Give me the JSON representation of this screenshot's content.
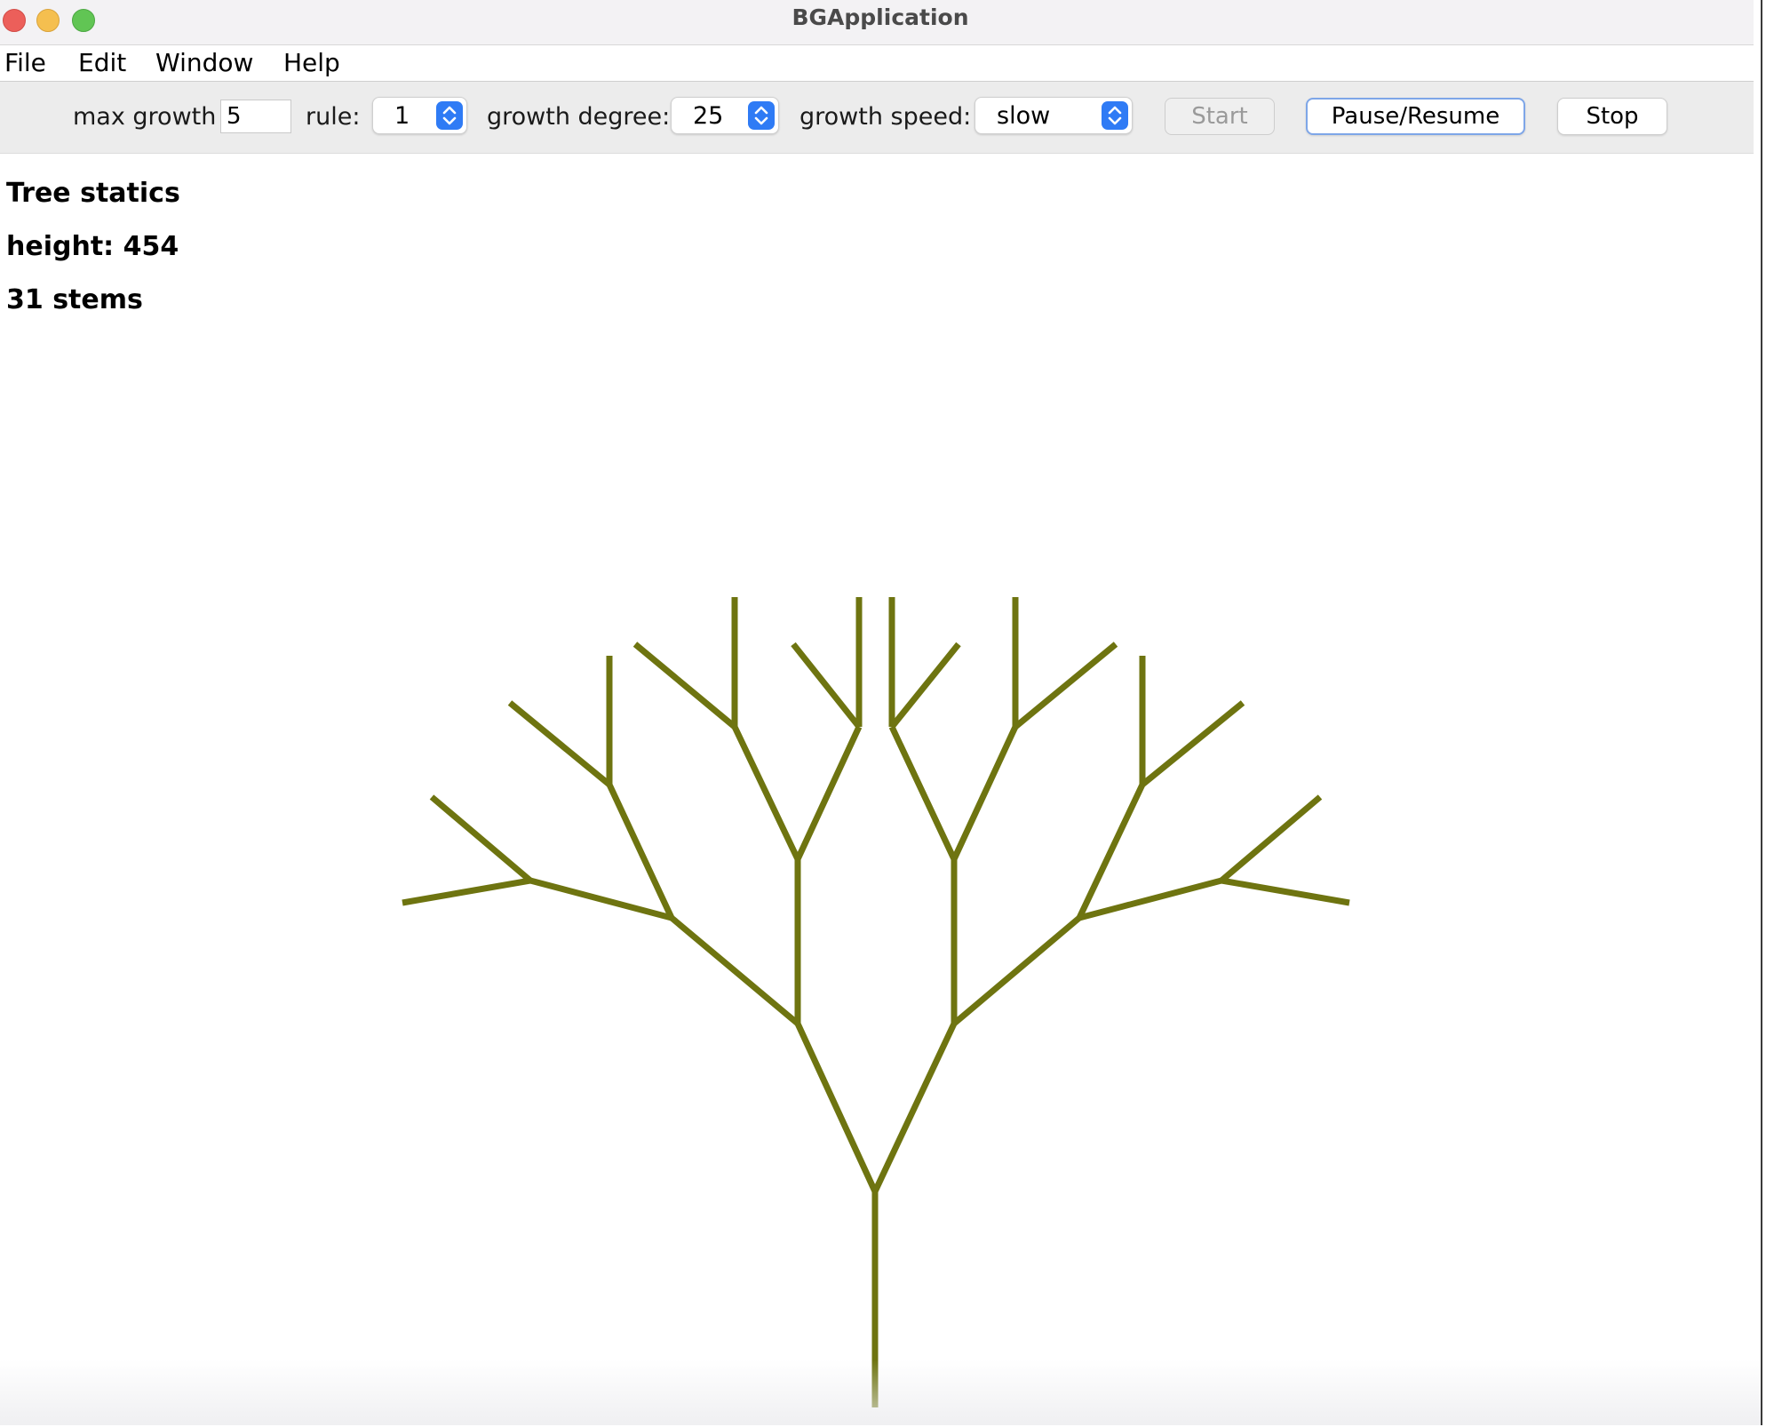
{
  "window": {
    "title": "BGApplication"
  },
  "menu": [
    "File",
    "Edit",
    "Window",
    "Help"
  ],
  "toolbar": {
    "max_growth_label": "max growth",
    "max_growth_value": "5",
    "rule_label": "rule:",
    "rule_value": "1",
    "growth_degree_label": "growth degree:",
    "growth_degree_value": "25",
    "growth_speed_label": "growth speed:",
    "growth_speed_value": "slow",
    "start_label": "Start",
    "pause_resume_label": "Pause/Resume",
    "stop_label": "Stop"
  },
  "stats": {
    "heading": "Tree statics",
    "height": "height: 454",
    "stems": "31 stems"
  },
  "tree": {
    "color": "#6e7410",
    "stem_count": 31
  }
}
